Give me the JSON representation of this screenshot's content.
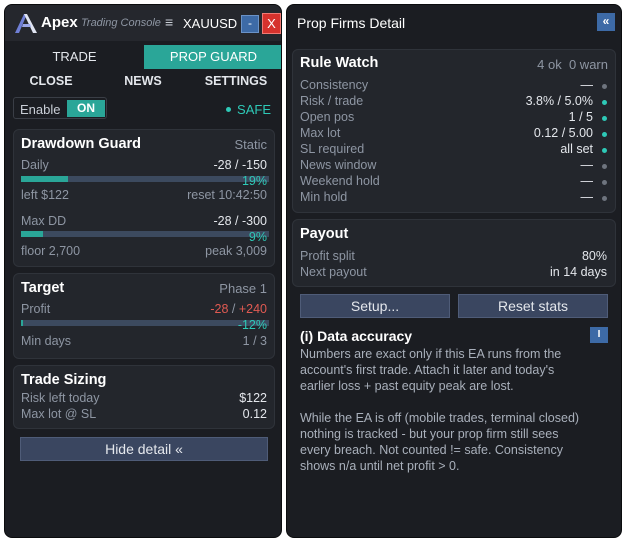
{
  "left": {
    "brand": "Apex",
    "subtitle": "Trading Console",
    "menu_icon": "≡",
    "symbol": "XAUUSD",
    "minimize": "-",
    "close": "X",
    "tabs": [
      "TRADE",
      "PROP GUARD"
    ],
    "subtabs": [
      "CLOSE",
      "NEWS",
      "SETTINGS"
    ],
    "enable_label": "Enable",
    "toggle": "ON",
    "status": "SAFE",
    "drawdown": {
      "title": "Drawdown Guard",
      "mode": "Static",
      "daily_label": "Daily",
      "daily_value": "-28 / -150",
      "daily_pct": "19%",
      "daily_fraction": 0.19,
      "left_label": "left $122",
      "reset_label": "reset 10:42:50",
      "maxdd_label": "Max DD",
      "maxdd_value": "-28 / -300",
      "maxdd_pct": "9%",
      "maxdd_fraction": 0.09,
      "floor_label": "floor 2,700",
      "peak_label": "peak 3,009"
    },
    "target": {
      "title": "Target",
      "phase": "Phase 1",
      "profit_label": "Profit",
      "profit_neg": "-28",
      "profit_sep": " / ",
      "profit_pos": "+240",
      "profit_pct": "-12%",
      "profit_fraction": 0.0,
      "min_days_label": "Min days",
      "min_days_value": "1 / 3"
    },
    "sizing": {
      "title": "Trade Sizing",
      "risk_label": "Risk left today",
      "risk_value": "$122",
      "maxlot_label": "Max lot @ SL",
      "maxlot_value": "0.12"
    },
    "hide_button": "Hide detail «"
  },
  "right": {
    "title": "Prop Firms Detail",
    "collapse": "«",
    "rules": {
      "title": "Rule Watch",
      "summary": "4 ok  0 warn",
      "items": [
        {
          "label": "Consistency",
          "value": "—",
          "status": "na"
        },
        {
          "label": "Risk / trade",
          "value": "3.8% / 5.0%",
          "status": "ok"
        },
        {
          "label": "Open pos",
          "value": "1 / 5",
          "status": "ok"
        },
        {
          "label": "Max lot",
          "value": "0.12 / 5.00",
          "status": "ok"
        },
        {
          "label": "SL required",
          "value": "all set",
          "status": "ok"
        },
        {
          "label": "News window",
          "value": "—",
          "status": "na"
        },
        {
          "label": "Weekend hold",
          "value": "—",
          "status": "na"
        },
        {
          "label": "Min hold",
          "value": "—",
          "status": "na"
        }
      ]
    },
    "payout": {
      "title": "Payout",
      "split_label": "Profit split",
      "split_value": "80%",
      "next_label": "Next payout",
      "next_value": "in 14 days"
    },
    "setup_button": "Setup...",
    "reset_button": "Reset stats",
    "info_title": "(i)  Data accuracy",
    "info_button": "I",
    "para1": "Numbers are exact only if this EA runs from the account's first trade. Attach it later and today's earlier loss + past equity peak are lost.",
    "para2": "While the EA is off (mobile trades, terminal closed) nothing is tracked - but your prop firm still sees every breach. Not counted != safe. Consistency shows n/a until net profit > 0."
  },
  "colors": {
    "accent": "#2aa698",
    "safe": "#2ec9b7",
    "negative": "#e05a52",
    "button": "#3a4660"
  }
}
